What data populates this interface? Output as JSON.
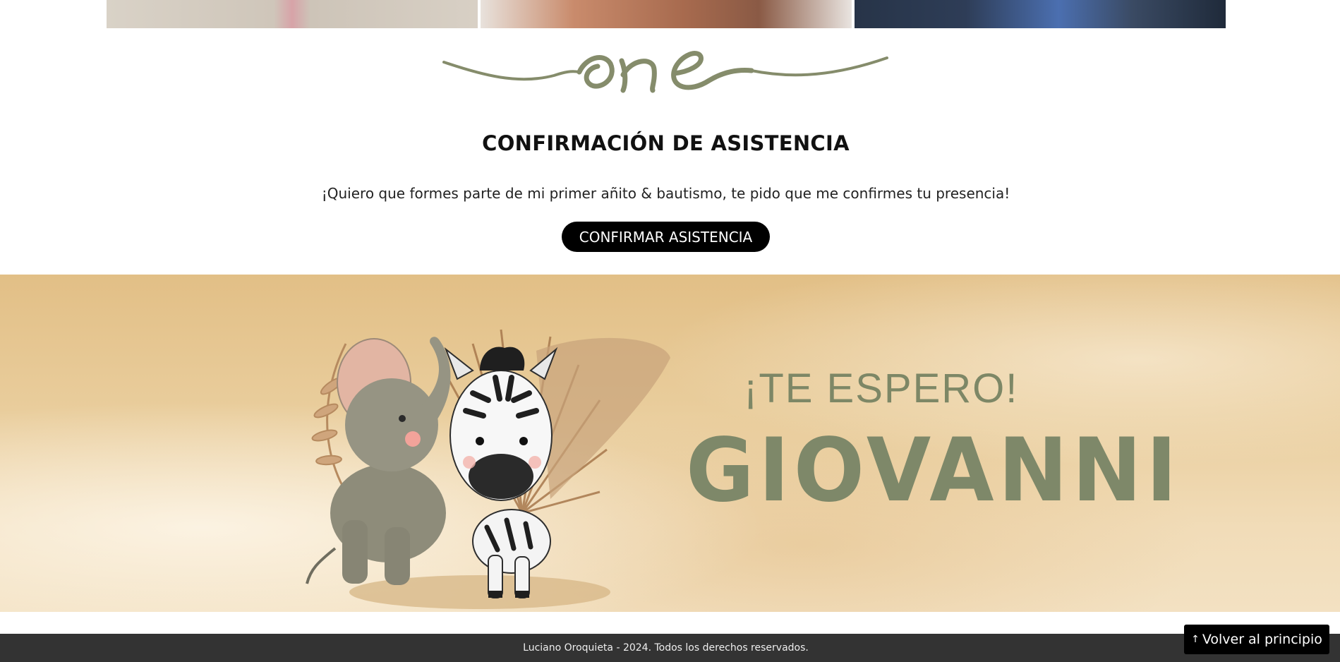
{
  "rsvp": {
    "title": "CONFIRMACIÓN DE ASISTENCIA",
    "message": "¡Quiero que formes parte de mi primer añito & bautismo, te pido que me confirmes tu presencia!",
    "button_label": "CONFIRMAR ASISTENCIA"
  },
  "banner": {
    "greeting": "¡TE ESPERO!",
    "name": "GIOVANNI"
  },
  "footer": {
    "copyright": "Luciano Oroquieta - 2024. Todos los derechos reservados."
  },
  "back_to_top": {
    "label": "Volver al principio",
    "icon": "arrow-up-icon"
  },
  "colors": {
    "accent_green": "#7e8869",
    "button_black": "#000000",
    "footer_bg": "#333333"
  }
}
